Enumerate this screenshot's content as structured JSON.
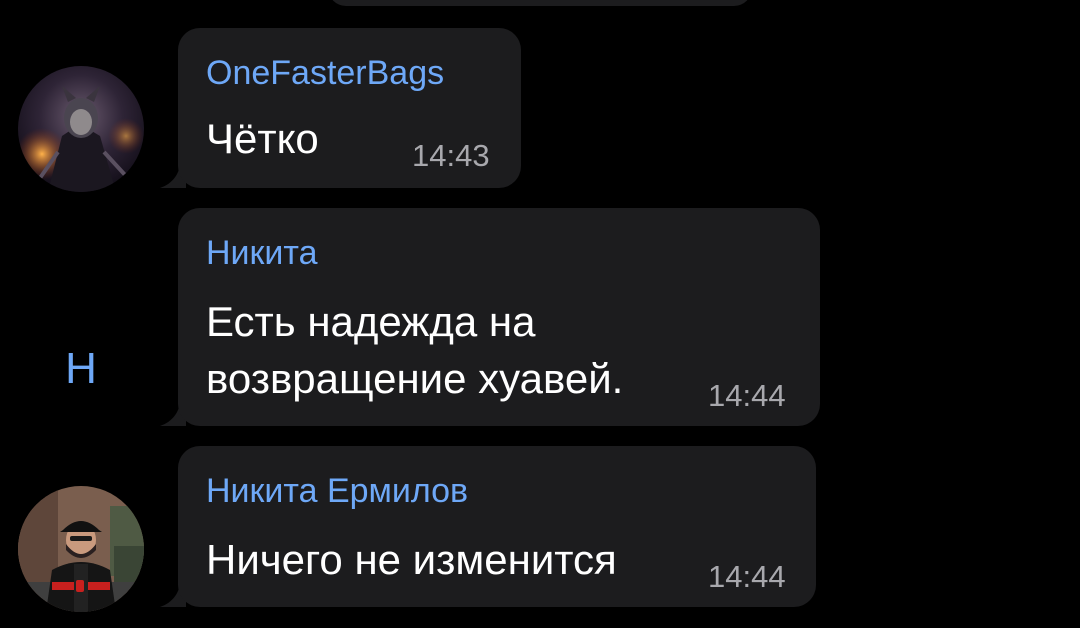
{
  "messages": [
    {
      "sender": "OneFasterBags",
      "text_lines": [
        "Чётко"
      ],
      "time": "14:43",
      "avatar_type": "image",
      "avatar_icon": "fantasy-warrior-avatar"
    },
    {
      "sender": "Никита",
      "text_lines": [
        "Есть надежда на",
        "возвращение хуавей."
      ],
      "time": "14:44",
      "avatar_type": "letter",
      "avatar_letter": "Н"
    },
    {
      "sender": "Никита Ермилов",
      "text_lines": [
        "Ничего не изменится"
      ],
      "time": "14:44",
      "avatar_type": "image",
      "avatar_icon": "man-in-cap-avatar"
    }
  ],
  "colors": {
    "background": "#000000",
    "bubble": "#1c1c1e",
    "sender_name": "#6ea8f7",
    "message_text": "#ffffff",
    "timestamp": "#a8a8ad"
  }
}
